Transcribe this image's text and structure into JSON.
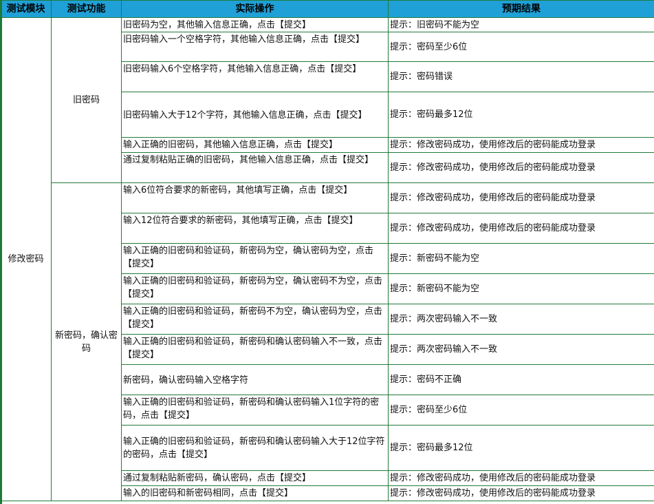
{
  "headers": [
    "测试模块",
    "测试功能",
    "实际操作",
    "预期结果"
  ],
  "module": "修改密码",
  "groups": [
    {
      "function": "旧密码",
      "rows": [
        {
          "action": "旧密码为空，其他输入信息正确，点击【提交】",
          "result": "提示：旧密码不能为空"
        },
        {
          "action": "旧密码输入一个空格字符，其他输入信息正确，点击【提交】",
          "result": "提示：密码至少6位"
        },
        {
          "action": "旧密码输入6个空格字符，其他输入信息正确，点击【提交】",
          "result": "提示：密码错误"
        },
        {
          "action": "旧密码输入大于12个字符，其他输入信息正确，点击【提交】",
          "result": "提示：密码最多12位"
        },
        {
          "action": "输入正确的旧密码，其他输入信息正确，点击【提交】",
          "result": "提示：修改密码成功，使用修改后的密码能成功登录"
        },
        {
          "action": "通过复制粘贴正确的旧密码，其他输入信息正确，点击【提交】",
          "result": "提示：修改密码成功，使用修改后的密码能成功登录"
        }
      ]
    },
    {
      "function": "新密码，确认密码",
      "rows": [
        {
          "action": "输入6位符合要求的新密码，其他填写正确，点击【提交】",
          "result": "提示：修改密码成功，使用修改后的密码能成功登录"
        },
        {
          "action": "输入12位符合要求的新密码，其他填写正确，点击【提交】",
          "result": "提示：修改密码成功，使用修改后的密码能成功登录"
        },
        {
          "action": "输入正确的旧密码和验证码，新密码为空，确认密码为空，点击【提交】",
          "result": "提示：新密码不能为空"
        },
        {
          "action": "输入正确的旧密码和验证码，新密码为空，确认密码不为空，点击【提交】",
          "result": "提示：新密码不能为空"
        },
        {
          "action": "输入正确的旧密码和验证码，新密码不为空，确认密码为空，点击【提交】",
          "result": "提示：两次密码输入不一致"
        },
        {
          "action": "输入正确的旧密码和验证码，新密码和确认密码输入不一致，点击【提交】",
          "result": "提示：两次密码输入不一致"
        },
        {
          "action": "新密码，确认密码输入空格字符",
          "result": "提示：密码不正确"
        },
        {
          "action": "输入正确的旧密码和验证码，新密码和确认密码输入1位字符的密码，点击【提交】",
          "result": "提示：密码至少6位"
        },
        {
          "action": "输入正确的旧密码和验证码，新密码和确认密码输入大于12位字符的密码，点击【提交】",
          "result": "提示：密码最多12位"
        },
        {
          "action": "通过复制粘贴新密码，确认密码，点击【提交】",
          "result": "提示：修改密码成功，使用修改后的密码能成功登录"
        },
        {
          "action": "输入的旧密码和新密码相同，点击【提交】",
          "result": "提示：修改密码成功，使用修改后的密码能成功登录"
        }
      ]
    }
  ]
}
